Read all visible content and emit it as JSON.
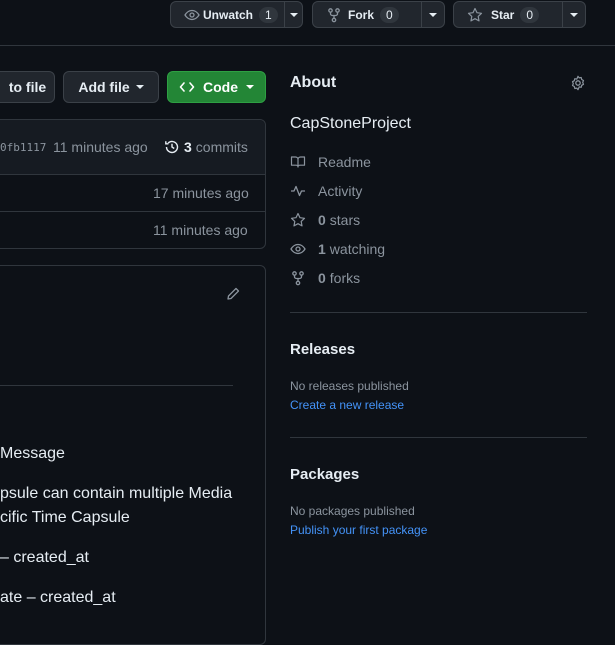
{
  "header": {
    "watch_label": "Unwatch",
    "watch_count": "1",
    "fork_label": "Fork",
    "fork_count": "0",
    "star_label": "Star",
    "star_count": "0"
  },
  "toolbar": {
    "goto_file_label": "to file",
    "add_file_label": "Add file",
    "code_label": "Code"
  },
  "commit_bar": {
    "hash": "0fb1117",
    "time": "11 minutes ago",
    "commits_count": "3",
    "commits_label": "commits"
  },
  "file_rows": [
    {
      "time": "17 minutes ago"
    },
    {
      "time": "11 minutes ago"
    }
  ],
  "readme": {
    "lines": [
      "Message",
      "psule can contain multiple Media",
      "cific Time Capsule",
      "– created_at",
      "ate – created_at"
    ]
  },
  "about": {
    "title": "About",
    "description": "CapStoneProject",
    "readme_label": "Readme",
    "activity_label": "Activity",
    "stars_count": "0",
    "stars_label": "stars",
    "watching_count": "1",
    "watching_label": "watching",
    "forks_count": "0",
    "forks_label": "forks"
  },
  "releases": {
    "title": "Releases",
    "empty_text": "No releases published",
    "create_link": "Create a new release"
  },
  "packages": {
    "title": "Packages",
    "empty_text": "No packages published",
    "publish_link": "Publish your first package"
  },
  "colors": {
    "background": "#0d1117",
    "border": "#30363d",
    "button_bg": "#21262d",
    "code_button": "#238636",
    "link": "#4493f8",
    "muted": "#8b949e"
  }
}
